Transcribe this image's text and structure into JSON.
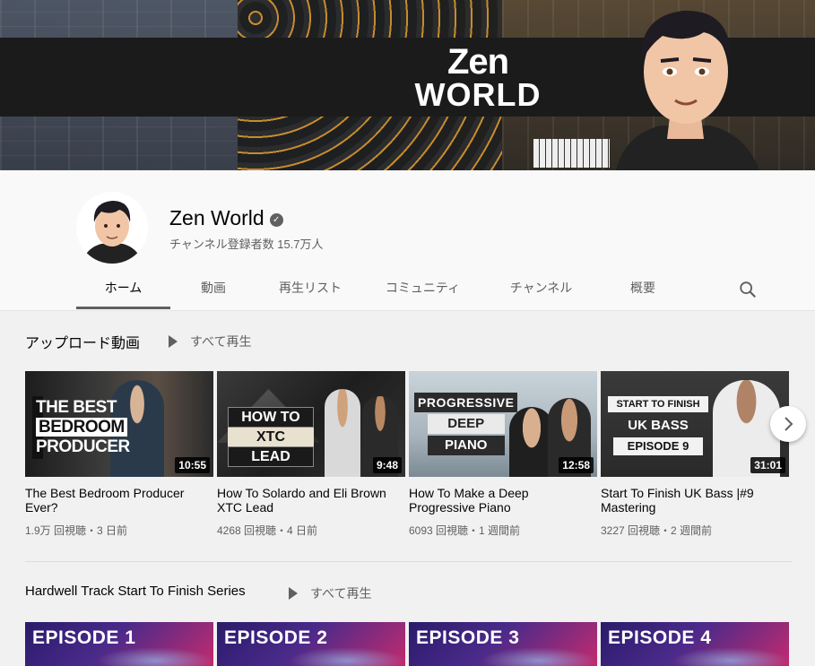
{
  "banner": {
    "logo_line1": "Zen",
    "logo_line2": "WORLD"
  },
  "channel": {
    "name": "Zen World",
    "subscribers": "チャンネル登録者数 15.7万人"
  },
  "tabs": [
    {
      "label": "ホーム",
      "active": true
    },
    {
      "label": "動画"
    },
    {
      "label": "再生リスト"
    },
    {
      "label": "コミュニティ"
    },
    {
      "label": "チャンネル"
    },
    {
      "label": "概要"
    }
  ],
  "uploads": {
    "title": "アップロード動画",
    "play_all": "すべて再生",
    "videos": [
      {
        "title": "The Best Bedroom Producer Ever?",
        "meta": "1.9万 回視聴・3 日前",
        "duration": "10:55",
        "thumb_text": [
          "THE BEST",
          "BEDROOM",
          "PRODUCER"
        ]
      },
      {
        "title": "How To Solardo and Eli Brown XTC Lead",
        "meta": "4268 回視聴・4 日前",
        "duration": "9:48",
        "thumb_text": [
          "HOW TO",
          "XTC",
          "LEAD"
        ]
      },
      {
        "title": "How To Make a Deep Progressive Piano",
        "meta": "6093 回視聴・1 週間前",
        "duration": "12:58",
        "thumb_text": [
          "PROGRESSIVE",
          "DEEP",
          "PIANO"
        ]
      },
      {
        "title": "Start To Finish UK Bass |#9 Mastering",
        "meta": "3227 回視聴・2 週間前",
        "duration": "31:01",
        "thumb_text": [
          "START TO FINISH",
          "UK BASS",
          "EPISODE 9"
        ]
      }
    ]
  },
  "series": {
    "title": "Hardwell Track Start To Finish Series",
    "play_all": "すべて再生",
    "episodes": [
      "EPISODE 1",
      "EPISODE 2",
      "EPISODE 3",
      "EPISODE 4"
    ]
  },
  "icons": {
    "search": "search-icon",
    "next": "chevron-right-icon",
    "verified": "verified-check-icon",
    "play": "play-icon"
  },
  "colors": {
    "accent_text": "#030303",
    "secondary_text": "#606060",
    "banner_dark": "#1b1b1b",
    "background": "#f1f1f1"
  }
}
